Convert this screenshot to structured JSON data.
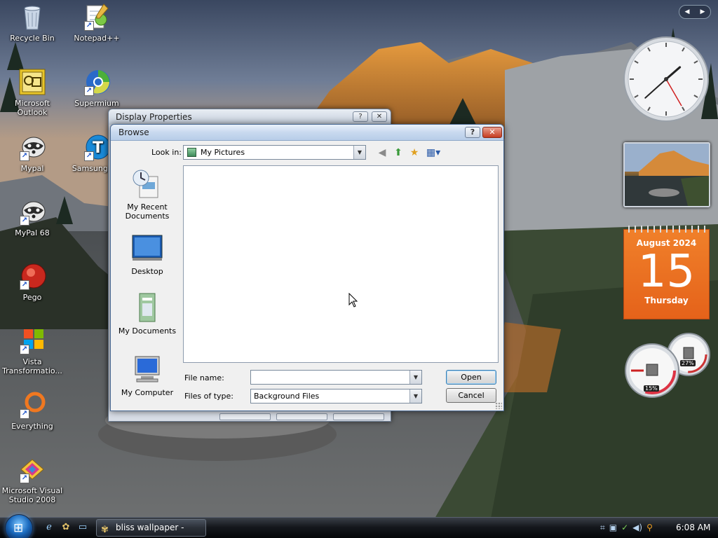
{
  "desktop": {
    "icons": [
      {
        "label": "Recycle Bin",
        "icon": "recycle-bin-icon"
      },
      {
        "label": "Notepad++",
        "icon": "notepad-icon"
      },
      {
        "label": "Microsoft Outlook",
        "icon": "outlook-icon"
      },
      {
        "label": "Supermium",
        "icon": "supermium-icon"
      },
      {
        "label": "Mypal",
        "icon": "mypal-icon"
      },
      {
        "label": "Samsung T...",
        "icon": "samsung-icon"
      },
      {
        "label": "MyPal 68",
        "icon": "mypal-icon"
      },
      {
        "label": "Pego",
        "icon": "pego-icon"
      },
      {
        "label": "Vista Transformatio...",
        "icon": "vista-icon"
      },
      {
        "label": "Everything",
        "icon": "everything-icon"
      },
      {
        "label": "Microsoft Visual Studio 2008",
        "icon": "visual-studio-icon"
      }
    ]
  },
  "gadgets": {
    "nav_prev": "◀",
    "nav_next": "▶",
    "calendar": {
      "month": "August 2024",
      "day": "15",
      "weekday": "Thursday"
    },
    "meters": {
      "cpu": "15%",
      "memory": "27%"
    },
    "clock": {
      "hour": 1,
      "minute": 38,
      "second": 25
    }
  },
  "display_properties": {
    "title": "Display Properties",
    "help": "?",
    "close": "✕"
  },
  "browse_dialog": {
    "title": "Browse",
    "help": "?",
    "close": "✕",
    "look_in_label": "Look in:",
    "look_in_value": "My Pictures",
    "places": [
      {
        "label": "My Recent Documents",
        "icon": "recent-documents-icon"
      },
      {
        "label": "Desktop",
        "icon": "desktop-icon"
      },
      {
        "label": "My Documents",
        "icon": "my-documents-icon"
      },
      {
        "label": "My Computer",
        "icon": "my-computer-icon"
      }
    ],
    "file_name_label": "File name:",
    "file_name_value": "",
    "files_of_type_label": "Files of type:",
    "files_of_type_value": "Background Files",
    "open_button": "Open",
    "cancel_button": "Cancel",
    "dropdown_arrow": "▼"
  },
  "taskbar": {
    "task_label": "bliss wallpaper - Go...",
    "time": "6:08 AM"
  },
  "colors": {
    "calendar_orange": "#e8661c",
    "title_blue": "#c8d9ef",
    "close_red": "#c53b20"
  }
}
